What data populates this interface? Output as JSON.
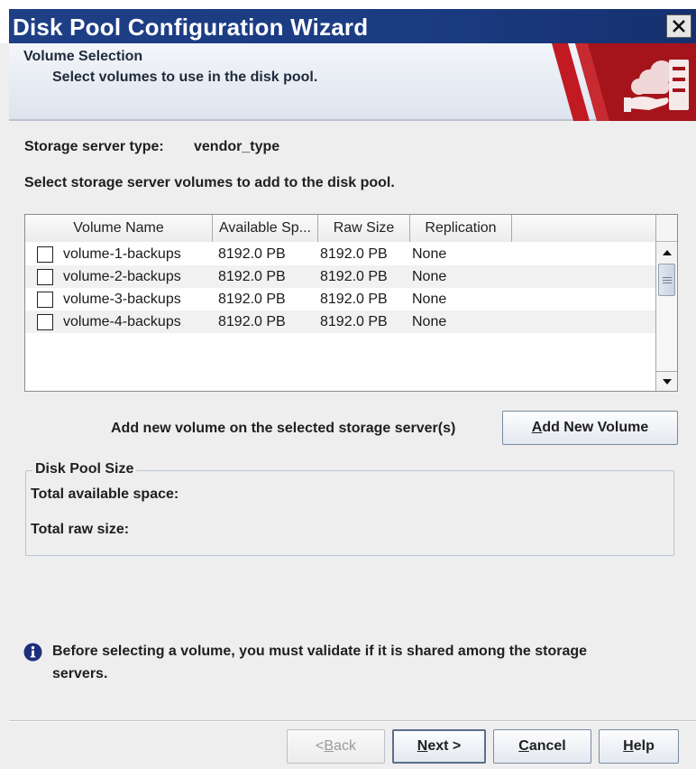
{
  "window": {
    "title": "Disk Pool Configuration Wizard",
    "close_label": "close"
  },
  "header": {
    "title": "Volume Selection",
    "subtitle": "Select volumes to use in the disk pool."
  },
  "storage_server": {
    "type_label": "Storage server type:",
    "type_value": "vendor_type"
  },
  "select_prompt": "Select storage server volumes to add to the disk pool.",
  "volumes_table": {
    "columns": [
      "Volume Name",
      "Available Sp...",
      "Raw Size",
      "Replication",
      ""
    ],
    "rows": [
      {
        "name": "volume-1-backups",
        "available": "8192.0 PB",
        "raw": "8192.0 PB",
        "replication": "None",
        "checked": false
      },
      {
        "name": "volume-2-backups",
        "available": "8192.0 PB",
        "raw": "8192.0 PB",
        "replication": "None",
        "checked": false
      },
      {
        "name": "volume-3-backups",
        "available": "8192.0 PB",
        "raw": "8192.0 PB",
        "replication": "None",
        "checked": false
      },
      {
        "name": "volume-4-backups",
        "available": "8192.0 PB",
        "raw": "8192.0 PB",
        "replication": "None",
        "checked": false
      }
    ]
  },
  "add_volume": {
    "prompt": "Add new volume on the selected storage server(s)",
    "button_mnemonic": "A",
    "button_rest": "dd New Volume"
  },
  "disk_pool_size": {
    "legend": "Disk Pool Size",
    "total_available_label": "Total available space:",
    "total_raw_label": "Total raw size:"
  },
  "info_note": {
    "line1": "Before selecting a volume, you must validate if it is shared among the storage",
    "line2": "servers."
  },
  "footer": {
    "back": {
      "prefix": "< ",
      "mnemonic": "B",
      "rest": "ack",
      "enabled": false
    },
    "next": {
      "mnemonic": "N",
      "rest": "ext >"
    },
    "cancel": {
      "mnemonic": "C",
      "rest": "ancel"
    },
    "help": {
      "mnemonic": "H",
      "rest": "elp"
    }
  },
  "colors": {
    "title_bar": "#1e3f86",
    "header_accent": "#b3121c",
    "window_bg": "#eeeeee"
  },
  "icons": {
    "close": "close-icon",
    "header_graphic": "storage-server-icon",
    "info": "info-icon",
    "scroll_up": "arrow-up-icon",
    "scroll_down": "arrow-down-icon"
  }
}
